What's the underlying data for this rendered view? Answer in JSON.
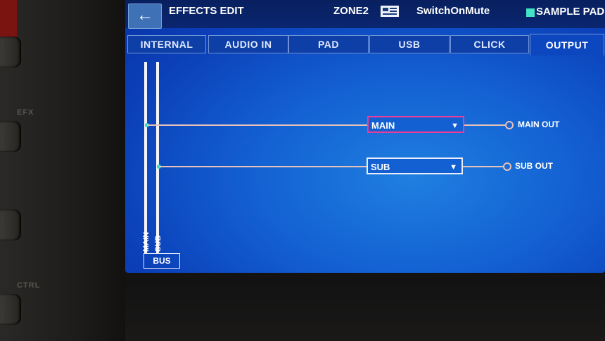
{
  "hardware": {
    "labels": [
      "EFX",
      "CTRL"
    ]
  },
  "header": {
    "back_icon": "←",
    "title": "EFFECTS EDIT",
    "zone": "ZONE2",
    "kit_name": "SwitchOnMute",
    "sample_pad": "SAMPLE PAD",
    "sample_pad_color": "#43e3c5"
  },
  "tabs": [
    {
      "label": "INTERNAL"
    },
    {
      "label": "AUDIO IN"
    },
    {
      "label": "PAD"
    },
    {
      "label": "USB"
    },
    {
      "label": "CLICK"
    },
    {
      "label": "OUTPUT",
      "active": true
    }
  ],
  "routing": {
    "bus_label": "BUS",
    "bus_lines": [
      "MAIN",
      "SUB"
    ],
    "outputs": [
      {
        "source": "MAIN",
        "select_value": "MAIN",
        "destination": "MAIN OUT",
        "focused": true
      },
      {
        "source": "SUB",
        "select_value": "SUB",
        "destination": "SUB OUT",
        "focused": false
      }
    ]
  },
  "colors": {
    "screen_blue": "#1360d2",
    "focus_border": "#e83e9a",
    "line": "#e7c2b8"
  }
}
